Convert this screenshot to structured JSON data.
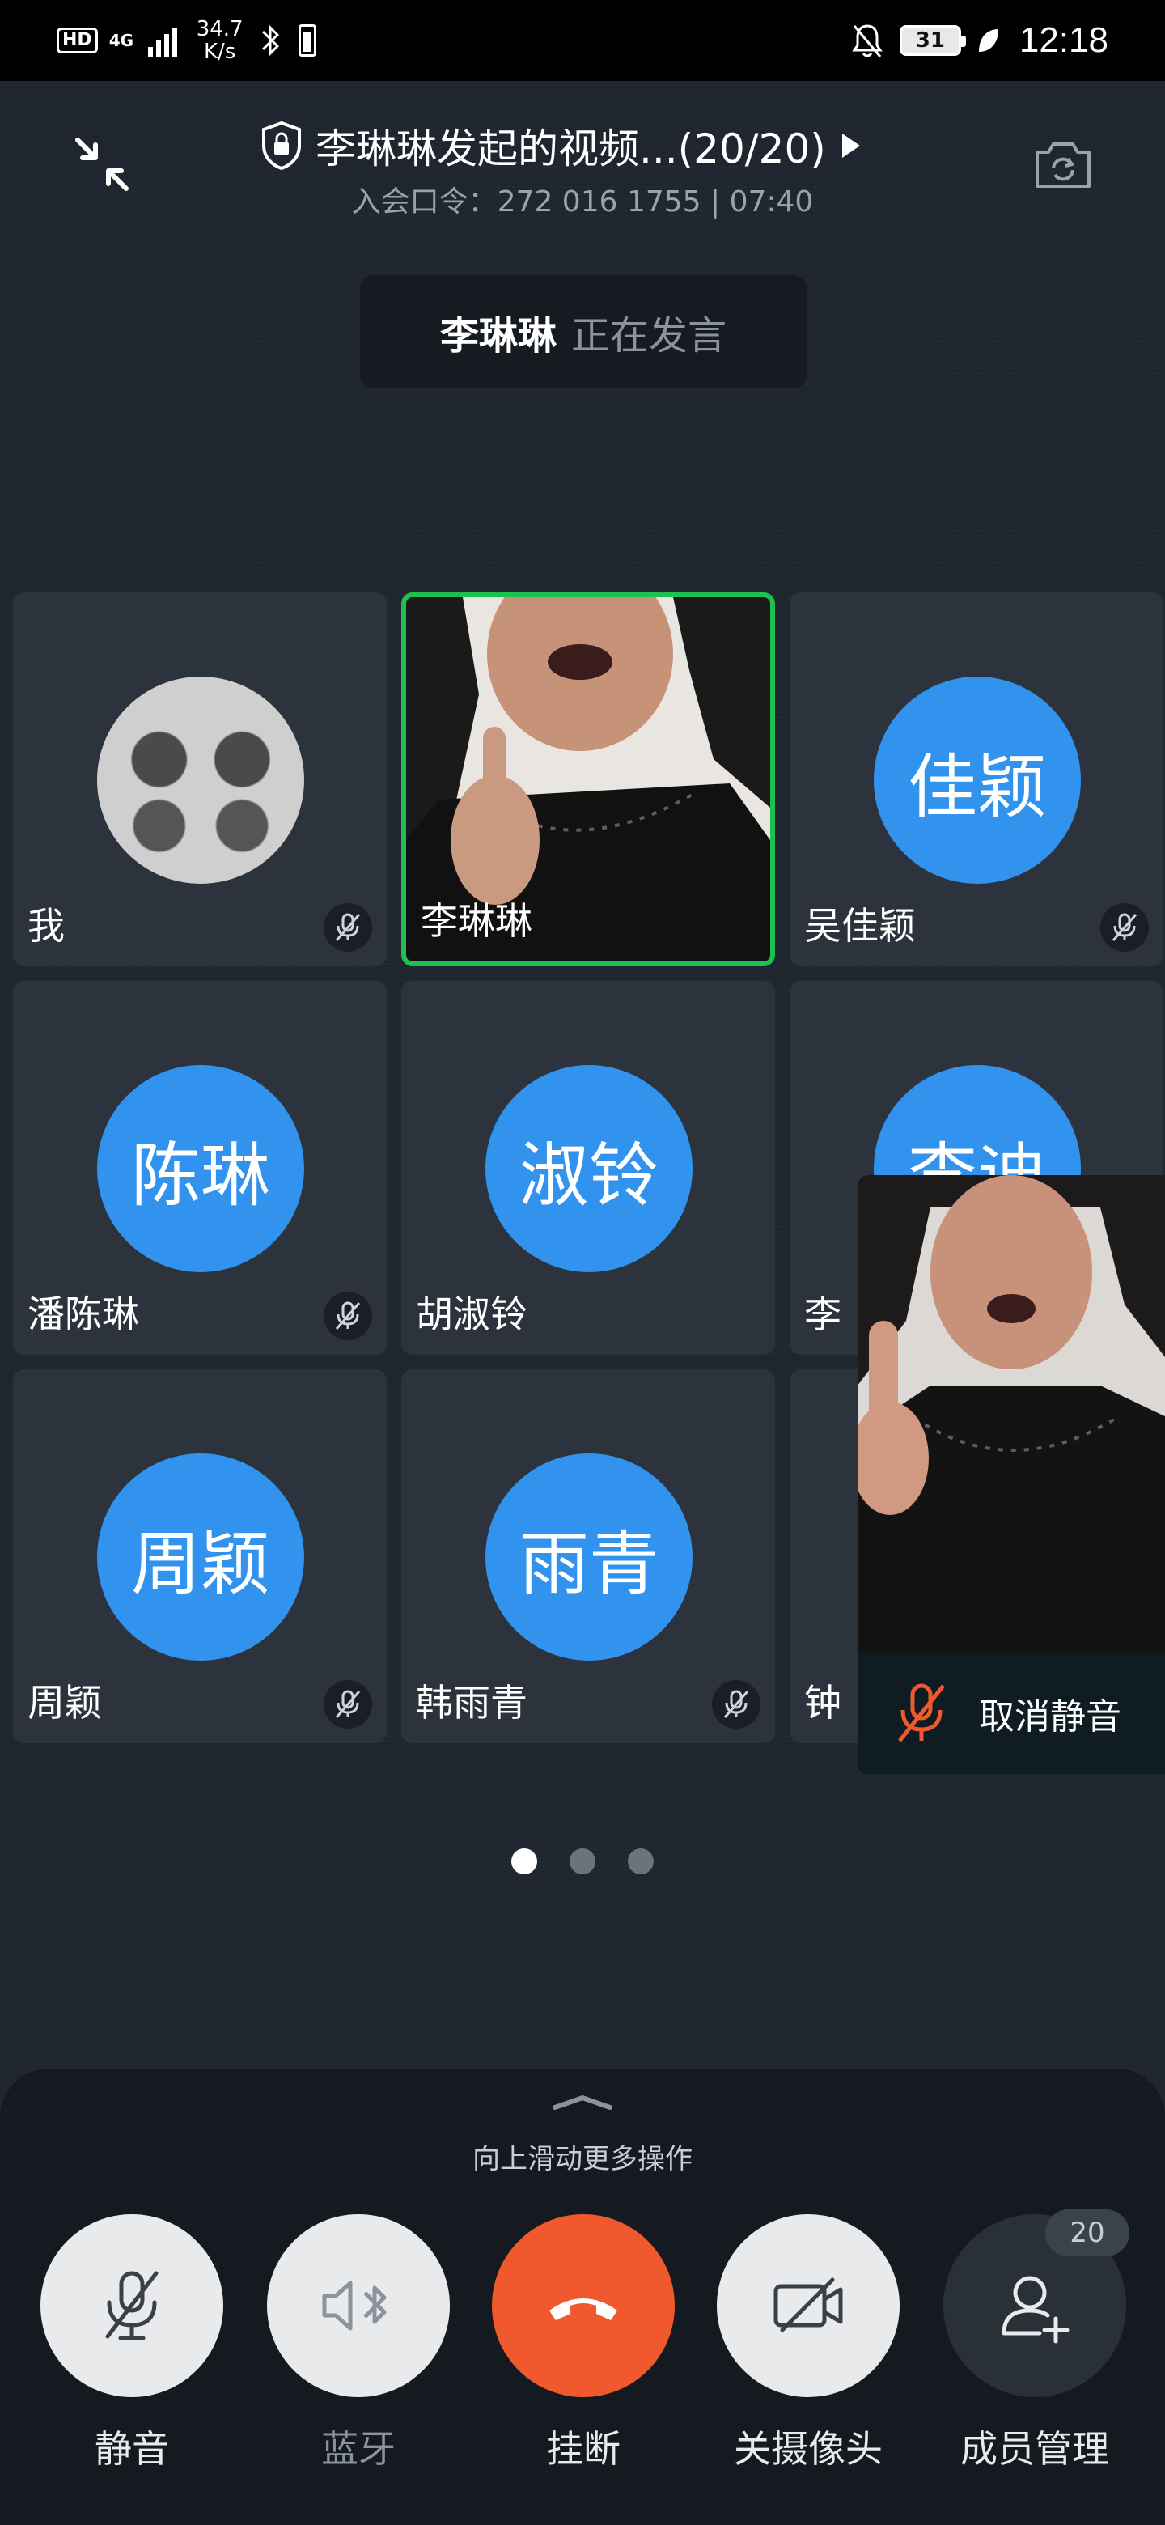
{
  "status_bar": {
    "hd": "HD",
    "network": "4G",
    "speed_value": "34.7",
    "speed_unit": "K/s",
    "battery": "31",
    "time": "12:18"
  },
  "meeting": {
    "title": "李琳琳发起的视频...(20/20)",
    "subtitle": "入会口令：272 016 1755 | 07:40"
  },
  "speaker": {
    "name": "李琳琳",
    "status": "正在发言"
  },
  "participants": [
    {
      "name": "我",
      "avatar_text": "",
      "avatar_type": "photo",
      "muted": true
    },
    {
      "name": "李琳琳",
      "avatar_text": "",
      "avatar_type": "video",
      "muted": false,
      "active": true
    },
    {
      "name": "吴佳颖",
      "avatar_text": "佳颖",
      "avatar_type": "initials",
      "muted": true
    },
    {
      "name": "潘陈琳",
      "avatar_text": "陈琳",
      "avatar_type": "initials",
      "muted": true
    },
    {
      "name": "胡淑铃",
      "avatar_text": "淑铃",
      "avatar_type": "initials",
      "muted": false
    },
    {
      "name": "李",
      "avatar_text": "李迪",
      "avatar_type": "initials",
      "muted": false
    },
    {
      "name": "周颖",
      "avatar_text": "周颖",
      "avatar_type": "initials",
      "muted": true
    },
    {
      "name": "韩雨青",
      "avatar_text": "雨青",
      "avatar_type": "initials",
      "muted": true
    },
    {
      "name": "钟",
      "avatar_text": "",
      "avatar_type": "initials",
      "muted": false
    }
  ],
  "self_video": {
    "unmute_label": "取消静音"
  },
  "pagination": {
    "current": 1,
    "total": 3
  },
  "bottom_panel": {
    "swipe_hint": "向上滑动更多操作",
    "controls": [
      {
        "label": "静音",
        "icon": "mic-off-icon"
      },
      {
        "label": "蓝牙",
        "icon": "bluetooth-speaker-icon"
      },
      {
        "label": "挂断",
        "icon": "hangup-icon"
      },
      {
        "label": "关摄像头",
        "icon": "camera-off-icon"
      },
      {
        "label": "成员管理",
        "icon": "add-member-icon"
      }
    ],
    "member_count": "20"
  },
  "colors": {
    "active_border": "#1ec04f",
    "avatar_blue": "#3193ee",
    "hangup_orange": "#f0582e",
    "unmute_orange": "#f0582e"
  }
}
